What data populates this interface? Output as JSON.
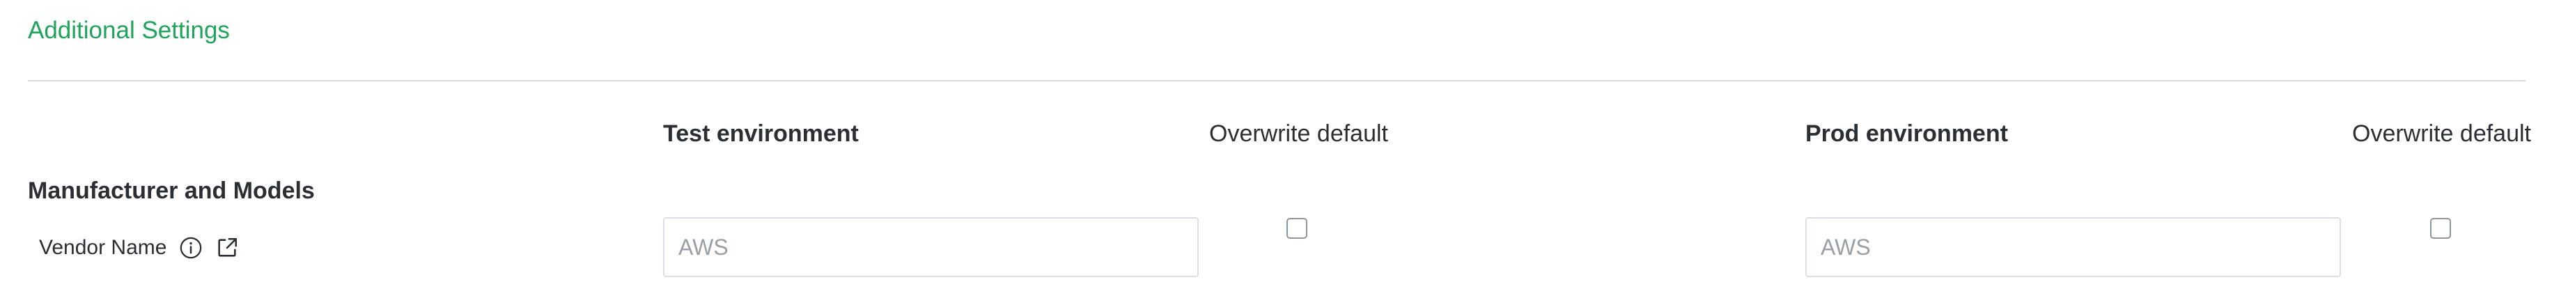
{
  "section": {
    "title": "Additional Settings"
  },
  "columns": {
    "test_env": "Test environment",
    "overwrite_test": "Overwrite default",
    "prod_env": "Prod environment",
    "overwrite_prod": "Overwrite default"
  },
  "group": {
    "title": "Manufacturer and Models"
  },
  "row": {
    "label": "Vendor Name",
    "info_icon": "info-circle",
    "link_icon": "external-link",
    "test_placeholder": "AWS",
    "prod_placeholder": "AWS",
    "test_overwrite_checked": false,
    "prod_overwrite_checked": false
  },
  "colors": {
    "accent": "#1ea55a",
    "divider": "#d9dcdf",
    "text": "#2b2f33"
  }
}
